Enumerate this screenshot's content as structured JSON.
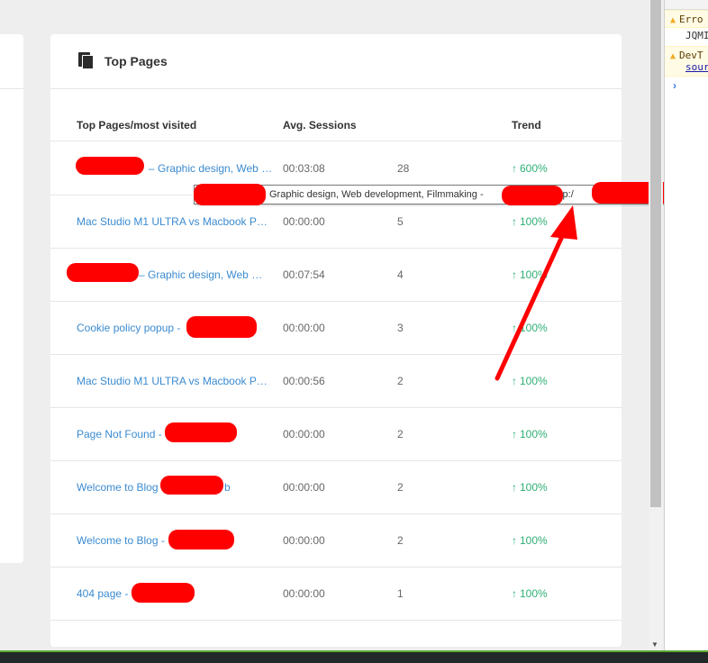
{
  "card": {
    "title": "Top Pages",
    "columns": {
      "page": "Top Pages/most visited",
      "sessions": "Avg. Sessions",
      "trend": "Trend"
    }
  },
  "rows": [
    {
      "title": "– Graphic design, Web d…",
      "time": "00:03:08",
      "count": "28",
      "trend": "600%"
    },
    {
      "title": "Mac Studio M1 ULTRA vs Macbook P…",
      "time": "00:00:00",
      "count": "5",
      "trend": "100%"
    },
    {
      "title": "– Graphic design, Web d…",
      "time": "00:07:54",
      "count": "4",
      "trend": "100%"
    },
    {
      "title": "Cookie policy popup -",
      "time": "00:00:00",
      "count": "3",
      "trend": "100%"
    },
    {
      "title": "Mac Studio M1 ULTRA vs Macbook P…",
      "time": "00:00:56",
      "count": "2",
      "trend": "100%"
    },
    {
      "title": "Page Not Found -",
      "time": "00:00:00",
      "count": "2",
      "trend": "100%"
    },
    {
      "title": "Welcome to Blog",
      "time": "00:00:00",
      "count": "2",
      "trend": "100%"
    },
    {
      "title": "Welcome to Blog -",
      "time": "00:00:00",
      "count": "2",
      "trend": "100%"
    },
    {
      "title": "404 page -",
      "time": "00:00:00",
      "count": "1",
      "trend": "100%"
    }
  ],
  "row3_suffix": "b",
  "tooltip": {
    "text": "Graphic design, Web development, Filmmaking -",
    "url_prefix": "(http:/"
  },
  "trend_arrow": "↑",
  "devtools": {
    "messages": [
      {
        "type": "warning",
        "text": "Erro"
      },
      {
        "type": "info",
        "text": "JQMI"
      },
      {
        "type": "warning",
        "text": "DevT",
        "link": "sour"
      }
    ],
    "prompt": "›"
  },
  "colors": {
    "link": "#3b8bd0",
    "trend_up": "#2eaf75",
    "redaction": "#ff0000",
    "annotation_arrow": "#ff0000",
    "taskbar_accent": "#5aa82f"
  },
  "icons": [
    "pages-icon",
    "arrow-up-icon",
    "warning-icon",
    "scroll-down-icon"
  ]
}
